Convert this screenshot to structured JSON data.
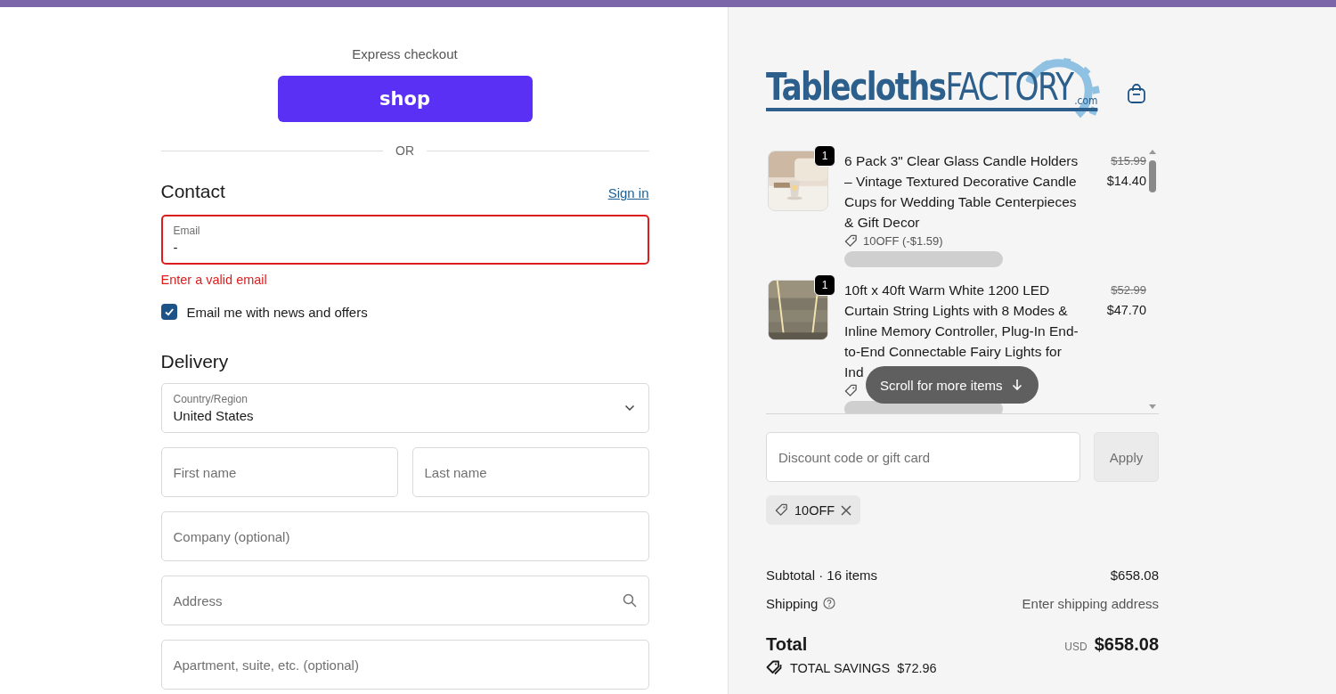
{
  "express": {
    "heading": "Express checkout",
    "shop_button": "shop"
  },
  "divider_text": "OR",
  "contact": {
    "heading": "Contact",
    "sign_in": "Sign in",
    "email": {
      "label": "Email",
      "value": "-",
      "error": "Enter a valid email"
    },
    "newsletter": {
      "label": "Email me with news and offers",
      "checked": true
    }
  },
  "delivery": {
    "heading": "Delivery",
    "country": {
      "label": "Country/Region",
      "value": "United States"
    },
    "rows": [
      [
        {
          "placeholder": "First name",
          "kind": "text"
        },
        {
          "placeholder": "Last name",
          "kind": "text"
        }
      ],
      [
        {
          "placeholder": "Company (optional)",
          "kind": "text"
        }
      ],
      [
        {
          "placeholder": "Address",
          "kind": "search"
        }
      ],
      [
        {
          "placeholder": "Apartment, suite, etc. (optional)",
          "kind": "text"
        }
      ]
    ]
  },
  "logo": {
    "main": "Tablecloths",
    "accent": "FACTORY",
    "suffix": ".com"
  },
  "cart_items": [
    {
      "title": "6 Pack 3\" Clear Glass Candle Holders – Vintage Textured Decorative Candle Cups for Wedding Table Centerpieces & Gift Decor",
      "quantity": "1",
      "original_price": "$15.99",
      "price": "$14.40",
      "has_discount": true,
      "discount": "10OFF (-$1.59)"
    },
    {
      "title": "10ft x 40ft Warm White 1200 LED Curtain String Lights with 8 Modes & Inline Memory Controller, Plug-In End-to-End Connectable Fairy Lights for Ind",
      "quantity": "1",
      "original_price": "$52.99",
      "price": "$47.70",
      "has_discount": true
    }
  ],
  "scroll_hint": "Scroll for more items",
  "discount": {
    "placeholder": "Discount code or gift card",
    "apply_button": "Apply",
    "apply_disabled": true
  },
  "applied_codes": [
    {
      "code": "10OFF"
    }
  ],
  "summary": {
    "subtotal_label": "Subtotal · 16 items",
    "subtotal": "$658.08",
    "shipping_label": "Shipping",
    "shipping_value": "Enter shipping address",
    "total_label": "Total",
    "currency": "USD",
    "total": "$658.08",
    "savings_label": "TOTAL SAVINGS",
    "savings": "$72.96"
  }
}
